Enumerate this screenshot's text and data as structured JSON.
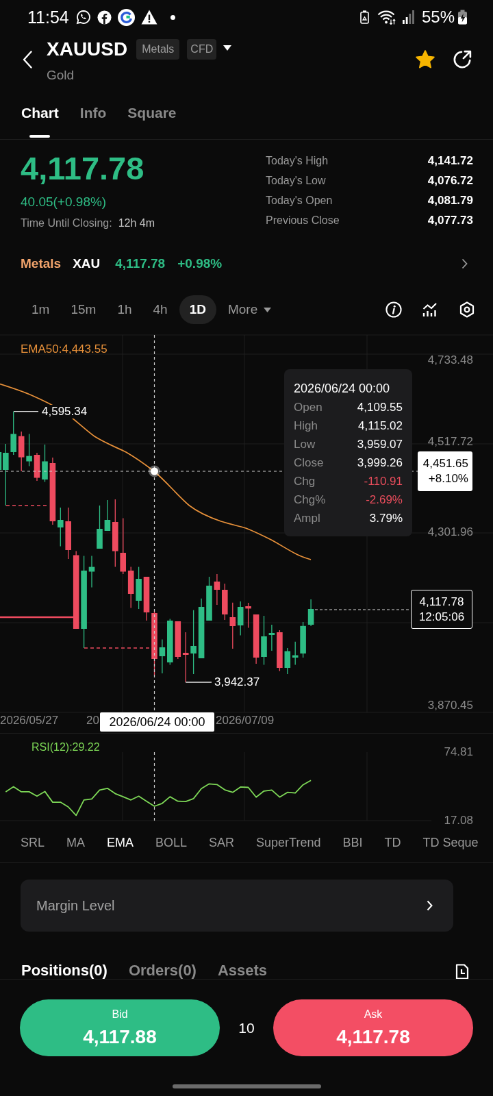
{
  "status_bar": {
    "time": "11:54",
    "battery": "55%"
  },
  "header": {
    "symbol": "XAUUSD",
    "tags": [
      "Metals",
      "CFD"
    ],
    "name": "Gold",
    "favorite": true
  },
  "tabs": [
    {
      "label": "Chart",
      "selected": true
    },
    {
      "label": "Info",
      "selected": false
    },
    {
      "label": "Square",
      "selected": false
    }
  ],
  "quote": {
    "price": "4,117.78",
    "change": "40.05(+0.98%)",
    "closing_label": "Time Until Closing:",
    "closing_time": "12h 4m",
    "stats": [
      {
        "label": "Today's High",
        "value": "4,141.72"
      },
      {
        "label": "Today's Low",
        "value": "4,076.72"
      },
      {
        "label": "Today's Open",
        "value": "4,081.79"
      },
      {
        "label": "Previous Close",
        "value": "4,077.73"
      }
    ]
  },
  "market_row": {
    "category": "Metals",
    "asset": "XAU",
    "price": "4,117.78",
    "change": "+0.98%"
  },
  "intervals": [
    {
      "label": "1m",
      "selected": false
    },
    {
      "label": "15m",
      "selected": false
    },
    {
      "label": "1h",
      "selected": false
    },
    {
      "label": "4h",
      "selected": false
    },
    {
      "label": "1D",
      "selected": true
    }
  ],
  "more_button": "More",
  "chart": {
    "ema_legend": "EMA50:4,443.55",
    "price_ticks": [
      "4,733.48",
      "4,517.72",
      "4,301.96",
      "3,870.45"
    ],
    "high_label": "4,595.34",
    "low_label": "3,942.37",
    "tooltip": {
      "date": "2026/06/24 00:00",
      "rows": [
        {
          "label": "Open",
          "value": "4,109.55",
          "color": "#ffffff"
        },
        {
          "label": "High",
          "value": "4,115.02",
          "color": "#ffffff"
        },
        {
          "label": "Low",
          "value": "3,959.07",
          "color": "#ffffff"
        },
        {
          "label": "Close",
          "value": "3,999.26",
          "color": "#ffffff"
        },
        {
          "label": "Chg",
          "value": "-110.91",
          "color": "#ea4d5c"
        },
        {
          "label": "Chg%",
          "value": "-2.69%",
          "color": "#ea4d5c"
        },
        {
          "label": "Ampl",
          "value": "3.79%",
          "color": "#ffffff"
        }
      ]
    },
    "crosshair_tag": {
      "price": "4,451.65",
      "change": "+8.10%"
    },
    "last_price_tag": {
      "price": "4,117.78",
      "countdown": "12:05:06"
    },
    "date_labels": [
      "2026/05/27",
      "20",
      "2026/07/09"
    ],
    "crosshair_date": "2026/06/24 00:00"
  },
  "rsi": {
    "legend": "RSI(12):29.22",
    "chart_data": {
      "type": "line",
      "categories": [
        null,
        null,
        null,
        null,
        null,
        null,
        null,
        null,
        null,
        null,
        null,
        null,
        null,
        null,
        null,
        null,
        null,
        null,
        null,
        null,
        null,
        null,
        null,
        null,
        null,
        null,
        null,
        null,
        null,
        null,
        null,
        null,
        null,
        null,
        null,
        null,
        null,
        null,
        null,
        null
      ],
      "series": [
        {
          "color": "#7ed957",
          "values": [
            41.4,
            45.7,
            41.4,
            41.4,
            37.7,
            41.7,
            32.6,
            32.6,
            28.6,
            21.5,
            34.5,
            35.3,
            42.8,
            44.3,
            39.8,
            37.2,
            34.5,
            37.7,
            33.4,
            29.2,
            31.6,
            37.2,
            33.4,
            33.2,
            35.6,
            44.1,
            48.1,
            47.5,
            43.0,
            40.9,
            45.4,
            45.1,
            36.9,
            42.0,
            42.8,
            36.9,
            40.9,
            40.4,
            47.3,
            51.0
          ]
        }
      ],
      "ylim": [
        17.08,
        74.81
      ],
      "yticks": [
        {
          "value": 17.08,
          "label": "17.08"
        },
        {
          "value": 74.81,
          "label": "74.81"
        }
      ]
    }
  },
  "indicators": [
    {
      "label": "SRL",
      "selected": false
    },
    {
      "label": "MA",
      "selected": false
    },
    {
      "label": "EMA",
      "selected": true
    },
    {
      "label": "BOLL",
      "selected": false
    },
    {
      "label": "SAR",
      "selected": false
    },
    {
      "label": "SuperTrend",
      "selected": false
    },
    {
      "label": "BBI",
      "selected": false
    },
    {
      "label": "TD",
      "selected": false
    },
    {
      "label": "TD Seque",
      "selected": false
    }
  ],
  "margin_level": "Margin Level",
  "bottom_tabs": [
    {
      "label": "Positions(0)",
      "selected": true
    },
    {
      "label": "Orders(0)",
      "selected": false
    },
    {
      "label": "Assets",
      "selected": false
    }
  ],
  "trade": {
    "bid": {
      "label": "Bid",
      "price": "4,117.88"
    },
    "spread": "10",
    "ask": {
      "label": "Ask",
      "price": "4,117.78"
    }
  }
}
